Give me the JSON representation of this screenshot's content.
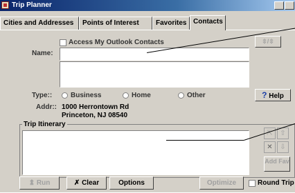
{
  "window": {
    "title": "Trip Planner"
  },
  "tabs": [
    {
      "label": "Cities and Addresses"
    },
    {
      "label": "Points of Interest"
    },
    {
      "label": "Favorites"
    },
    {
      "label": "Contacts"
    }
  ],
  "contacts": {
    "access_outlook_label": "Access My Outlook Contacts",
    "name_label": "Name:",
    "name_value": "",
    "type_label": "Type::",
    "type_options": [
      "Business",
      "Home",
      "Other"
    ],
    "addr_label": "Addr::",
    "addr_line1": "1000 Herrontown Rd",
    "addr_line2": "Princeton, NJ 08540",
    "help_label": "Help"
  },
  "itinerary": {
    "label": "Trip Itinerary",
    "add_fav_label": "Add Fav"
  },
  "footer": {
    "run_label": "Run",
    "clear_label": "Clear",
    "options_label": "Options",
    "optimize_label": "Optimize",
    "round_trip_label": "Round Trip"
  }
}
